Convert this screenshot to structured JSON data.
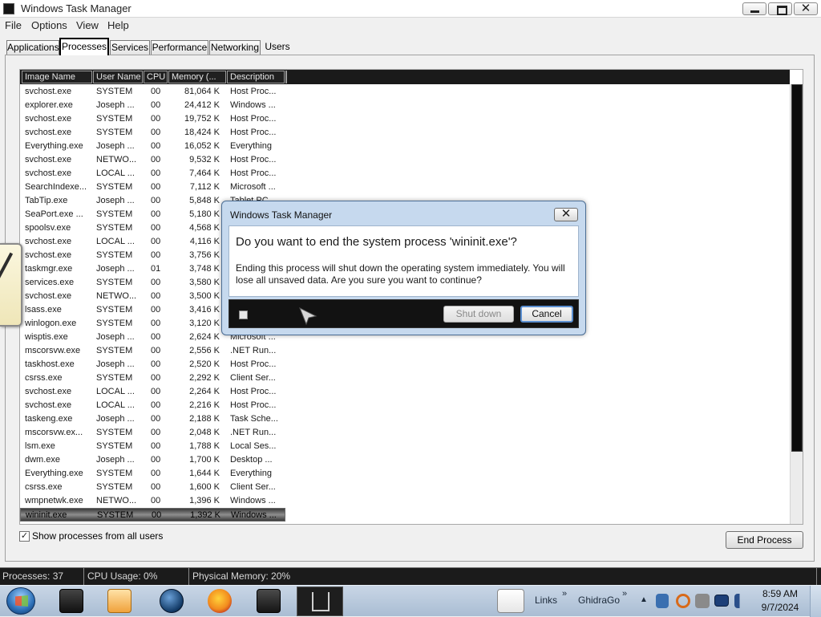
{
  "window": {
    "title": "Windows Task Manager"
  },
  "menu": [
    "File",
    "Options",
    "View",
    "Help"
  ],
  "tabs": [
    "Applications",
    "Processes",
    "Services",
    "Performance",
    "Networking",
    "Users"
  ],
  "columns": [
    "Image Name",
    "User Name",
    "CPU",
    "Memory (...",
    "Description"
  ],
  "processes": [
    {
      "name": "svchost.exe",
      "user": "SYSTEM",
      "cpu": "00",
      "mem": "81,064 K",
      "desc": "Host Proc..."
    },
    {
      "name": "explorer.exe",
      "user": "Joseph ...",
      "cpu": "00",
      "mem": "24,412 K",
      "desc": "Windows ..."
    },
    {
      "name": "svchost.exe",
      "user": "SYSTEM",
      "cpu": "00",
      "mem": "19,752 K",
      "desc": "Host Proc..."
    },
    {
      "name": "svchost.exe",
      "user": "SYSTEM",
      "cpu": "00",
      "mem": "18,424 K",
      "desc": "Host Proc..."
    },
    {
      "name": "Everything.exe",
      "user": "Joseph ...",
      "cpu": "00",
      "mem": "16,052 K",
      "desc": "Everything"
    },
    {
      "name": "svchost.exe",
      "user": "NETWO...",
      "cpu": "00",
      "mem": "9,532 K",
      "desc": "Host Proc..."
    },
    {
      "name": "svchost.exe",
      "user": "LOCAL ...",
      "cpu": "00",
      "mem": "7,464 K",
      "desc": "Host Proc..."
    },
    {
      "name": "SearchIndexe...",
      "user": "SYSTEM",
      "cpu": "00",
      "mem": "7,112 K",
      "desc": "Microsoft ..."
    },
    {
      "name": "TabTip.exe",
      "user": "Joseph ...",
      "cpu": "00",
      "mem": "5,848 K",
      "desc": "Tablet PC ..."
    },
    {
      "name": "SeaPort.exe ...",
      "user": "SYSTEM",
      "cpu": "00",
      "mem": "5,180 K",
      "desc": ""
    },
    {
      "name": "spoolsv.exe",
      "user": "SYSTEM",
      "cpu": "00",
      "mem": "4,568 K",
      "desc": ""
    },
    {
      "name": "svchost.exe",
      "user": "LOCAL ...",
      "cpu": "00",
      "mem": "4,116 K",
      "desc": ""
    },
    {
      "name": "svchost.exe",
      "user": "SYSTEM",
      "cpu": "00",
      "mem": "3,756 K",
      "desc": ""
    },
    {
      "name": "taskmgr.exe",
      "user": "Joseph ...",
      "cpu": "01",
      "mem": "3,748 K",
      "desc": ""
    },
    {
      "name": "services.exe",
      "user": "SYSTEM",
      "cpu": "00",
      "mem": "3,580 K",
      "desc": ""
    },
    {
      "name": "svchost.exe",
      "user": "NETWO...",
      "cpu": "00",
      "mem": "3,500 K",
      "desc": ""
    },
    {
      "name": "lsass.exe",
      "user": "SYSTEM",
      "cpu": "00",
      "mem": "3,416 K",
      "desc": ""
    },
    {
      "name": "winlogon.exe",
      "user": "SYSTEM",
      "cpu": "00",
      "mem": "3,120 K",
      "desc": ""
    },
    {
      "name": "wisptis.exe",
      "user": "Joseph ...",
      "cpu": "00",
      "mem": "2,624 K",
      "desc": "Microsoft ..."
    },
    {
      "name": "mscorsvw.exe",
      "user": "SYSTEM",
      "cpu": "00",
      "mem": "2,556 K",
      "desc": ".NET Run..."
    },
    {
      "name": "taskhost.exe",
      "user": "Joseph ...",
      "cpu": "00",
      "mem": "2,520 K",
      "desc": "Host Proc..."
    },
    {
      "name": "csrss.exe",
      "user": "SYSTEM",
      "cpu": "00",
      "mem": "2,292 K",
      "desc": "Client Ser..."
    },
    {
      "name": "svchost.exe",
      "user": "LOCAL ...",
      "cpu": "00",
      "mem": "2,264 K",
      "desc": "Host Proc..."
    },
    {
      "name": "svchost.exe",
      "user": "LOCAL ...",
      "cpu": "00",
      "mem": "2,216 K",
      "desc": "Host Proc..."
    },
    {
      "name": "taskeng.exe",
      "user": "Joseph ...",
      "cpu": "00",
      "mem": "2,188 K",
      "desc": "Task Sche..."
    },
    {
      "name": "mscorsvw.ex...",
      "user": "SYSTEM",
      "cpu": "00",
      "mem": "2,048 K",
      "desc": ".NET Run..."
    },
    {
      "name": "lsm.exe",
      "user": "SYSTEM",
      "cpu": "00",
      "mem": "1,788 K",
      "desc": "Local Ses..."
    },
    {
      "name": "dwm.exe",
      "user": "Joseph ...",
      "cpu": "00",
      "mem": "1,700 K",
      "desc": "Desktop ..."
    },
    {
      "name": "Everything.exe",
      "user": "SYSTEM",
      "cpu": "00",
      "mem": "1,644 K",
      "desc": "Everything"
    },
    {
      "name": "csrss.exe",
      "user": "SYSTEM",
      "cpu": "00",
      "mem": "1,600 K",
      "desc": "Client Ser..."
    },
    {
      "name": "wmpnetwk.exe",
      "user": "NETWO...",
      "cpu": "00",
      "mem": "1,396 K",
      "desc": "Windows ..."
    },
    {
      "name": "wininit.exe",
      "user": "SYSTEM",
      "cpu": "00",
      "mem": "1,392 K",
      "desc": "Windows ...",
      "selected": true
    }
  ],
  "show_all_label": "Show processes from all users",
  "show_all_checked": true,
  "end_process_label": "End Process",
  "status": {
    "processes": "Processes: 37",
    "cpu": "CPU Usage: 0%",
    "memory": "Physical Memory: 20%"
  },
  "dialog": {
    "title": "Windows Task Manager",
    "heading": "Do you want to end the system process 'wininit.exe'?",
    "message": "Ending this process will shut down the operating system immediately.  You will lose all unsaved data.  Are you sure you want to continue?",
    "shutdown_label": "Shut down",
    "cancel_label": "Cancel"
  },
  "taskbar": {
    "links_label": "Links",
    "ghidra_label": "GhidraGo",
    "time": "8:59 AM",
    "date": "9/7/2024"
  },
  "colors": {
    "accent": "#4b6d94",
    "selection": "#3a3a3a",
    "header_bg": "#1a1a1a"
  }
}
